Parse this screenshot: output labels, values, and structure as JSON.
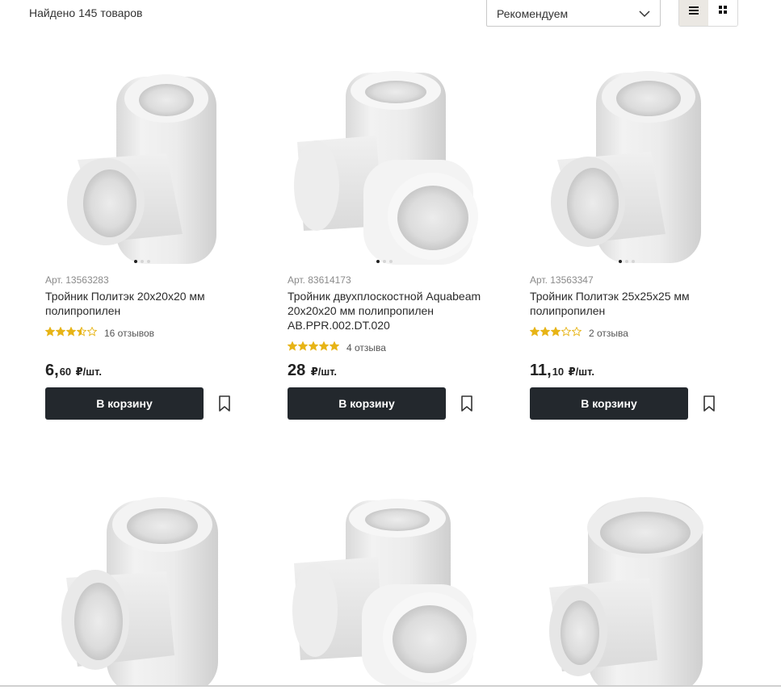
{
  "toolbar": {
    "found_text": "Найдено 145 товаров",
    "sort_selected": "Рекомендуем",
    "view_list_icon": "list-icon",
    "view_grid_icon": "grid-icon"
  },
  "colors": {
    "button_bg": "#23282d",
    "star_filled": "#e7b416",
    "star_empty": "#d8c27a",
    "active_toggle": "#ebe8e3"
  },
  "products": [
    {
      "sku": "Арт. 13563283",
      "title": "Тройник Политэк 20х20х20 мм полипропилен",
      "rating": 3.5,
      "reviews": "16 отзывов",
      "price_int": "6,",
      "price_frac": "60",
      "price_unit": "₽/шт.",
      "cart_label": "В корзину",
      "image": "tee-fitting"
    },
    {
      "sku": "Арт. 83614173",
      "title": "Тройник двухплоскостной Aquabeam 20x20x20 мм полипропилен AB.PPR.002.DT.020",
      "rating": 5,
      "reviews": "4 отзыва",
      "price_int": "28",
      "price_frac": "",
      "price_unit": "₽/шт.",
      "cart_label": "В корзину",
      "image": "cross-fitting"
    },
    {
      "sku": "Арт. 13563347",
      "title": "Тройник Политэк 25х25х25 мм полипропилен",
      "rating": 3,
      "reviews": "2 отзыва",
      "price_int": "11,",
      "price_frac": "10",
      "price_unit": "₽/шт.",
      "cart_label": "В корзину",
      "image": "tee-fitting"
    },
    {
      "image": "tee-fitting"
    },
    {
      "image": "cross-fitting"
    },
    {
      "image": "tee-fitting"
    }
  ]
}
